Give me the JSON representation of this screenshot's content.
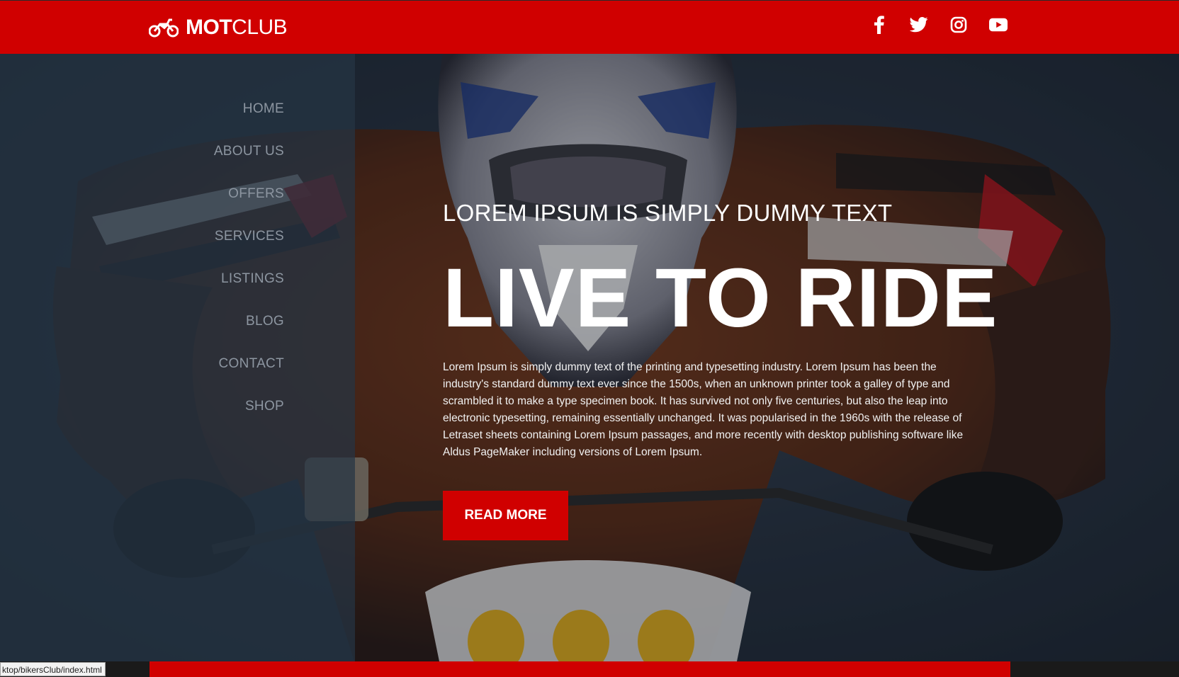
{
  "header": {
    "brand_bold": "MOT",
    "brand_light": "CLUB",
    "logo_icon": "motorcycle-icon",
    "social": [
      {
        "name": "facebook-icon"
      },
      {
        "name": "twitter-icon"
      },
      {
        "name": "instagram-icon"
      },
      {
        "name": "youtube-icon"
      }
    ]
  },
  "nav": {
    "items": [
      {
        "label": "HOME"
      },
      {
        "label": "ABOUT US"
      },
      {
        "label": "OFFERS"
      },
      {
        "label": "SERVICES"
      },
      {
        "label": "LISTINGS"
      },
      {
        "label": "BLOG"
      },
      {
        "label": "CONTACT"
      },
      {
        "label": "SHOP"
      }
    ]
  },
  "hero": {
    "subtitle": "LOREM IPSUM IS SIMPLY DUMMY TEXT",
    "title": "LIVE TO RIDE",
    "description": "Lorem Ipsum is simply dummy text of the printing and typesetting industry. Lorem Ipsum has been the industry's standard dummy text ever since the 1500s, when an unknown printer took a galley of type and scrambled it to make a type specimen book. It has survived not only five centuries, but also the leap into electronic typesetting, remaining essentially unchanged. It was popularised in the 1960s with the release of Letraset sheets containing Lorem Ipsum passages, and more recently with desktop publishing software like Aldus PageMaker including versions of Lorem Ipsum.",
    "cta_label": "READ MORE"
  },
  "status_bar": {
    "url": "ktop/bikersClub/index.html"
  },
  "colors": {
    "brand_red": "#d00000",
    "nav_text": "#8d96a1",
    "panel": "#263444"
  }
}
